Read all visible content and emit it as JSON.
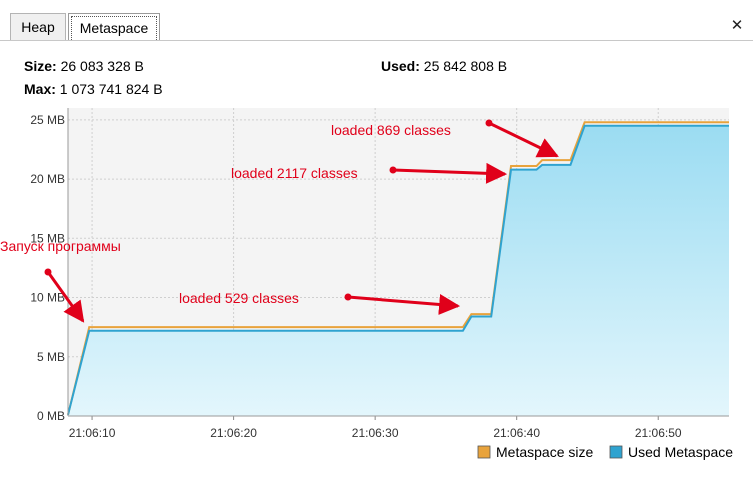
{
  "tabs": [
    {
      "label": "Heap",
      "active": false
    },
    {
      "label": "Metaspace",
      "active": true
    }
  ],
  "close_symbol": "✕",
  "stats": {
    "size_label": "Size:",
    "size_value": "26 083 328 B",
    "used_label": "Used:",
    "used_value": "25 842 808 B",
    "max_label": "Max:",
    "max_value": "1 073 741 824 B"
  },
  "chart_data": {
    "type": "area",
    "y_ticks": [
      "0 MB",
      "5 MB",
      "10 MB",
      "15 MB",
      "20 MB",
      "25 MB"
    ],
    "y_tick_values": [
      0,
      5,
      10,
      15,
      20,
      25
    ],
    "ylim": [
      0,
      26
    ],
    "x_ticks": [
      "21:06:10",
      "21:06:20",
      "21:06:30",
      "21:06:40",
      "21:06:50"
    ],
    "x_tick_values": [
      10,
      20,
      30,
      40,
      50
    ],
    "xlim": [
      8.3,
      55.0
    ],
    "grid": true,
    "legend_position": "bottom-right",
    "colors": {
      "metaspace_size": "#e8a33c",
      "used_metaspace": "#2fa3d0",
      "fill_top": "#9bdcf2",
      "fill_bottom": "#e3f6fc",
      "annotation": "#e0001a",
      "plot_bg": "#f4f4f4"
    },
    "series": [
      {
        "name": "Metaspace size",
        "x": [
          8.3,
          9.8,
          36.2,
          36.8,
          38.2,
          39.6,
          41.4,
          41.8,
          43.8,
          44.8,
          55.0
        ],
        "y": [
          0.1,
          7.5,
          7.5,
          8.6,
          8.6,
          21.1,
          21.1,
          21.6,
          21.6,
          24.8,
          24.8
        ]
      },
      {
        "name": "Used Metaspace",
        "x": [
          8.3,
          9.8,
          36.2,
          36.8,
          38.2,
          39.6,
          41.4,
          41.8,
          43.8,
          44.8,
          55.0
        ],
        "y": [
          0.1,
          7.2,
          7.2,
          8.4,
          8.4,
          20.8,
          20.8,
          21.2,
          21.2,
          24.5,
          24.5
        ]
      }
    ],
    "annotations": [
      {
        "text": "Запуск программы"
      },
      {
        "text": "loaded 529 classes"
      },
      {
        "text": "loaded 2117 classes"
      },
      {
        "text": "loaded 869 classes"
      }
    ]
  }
}
